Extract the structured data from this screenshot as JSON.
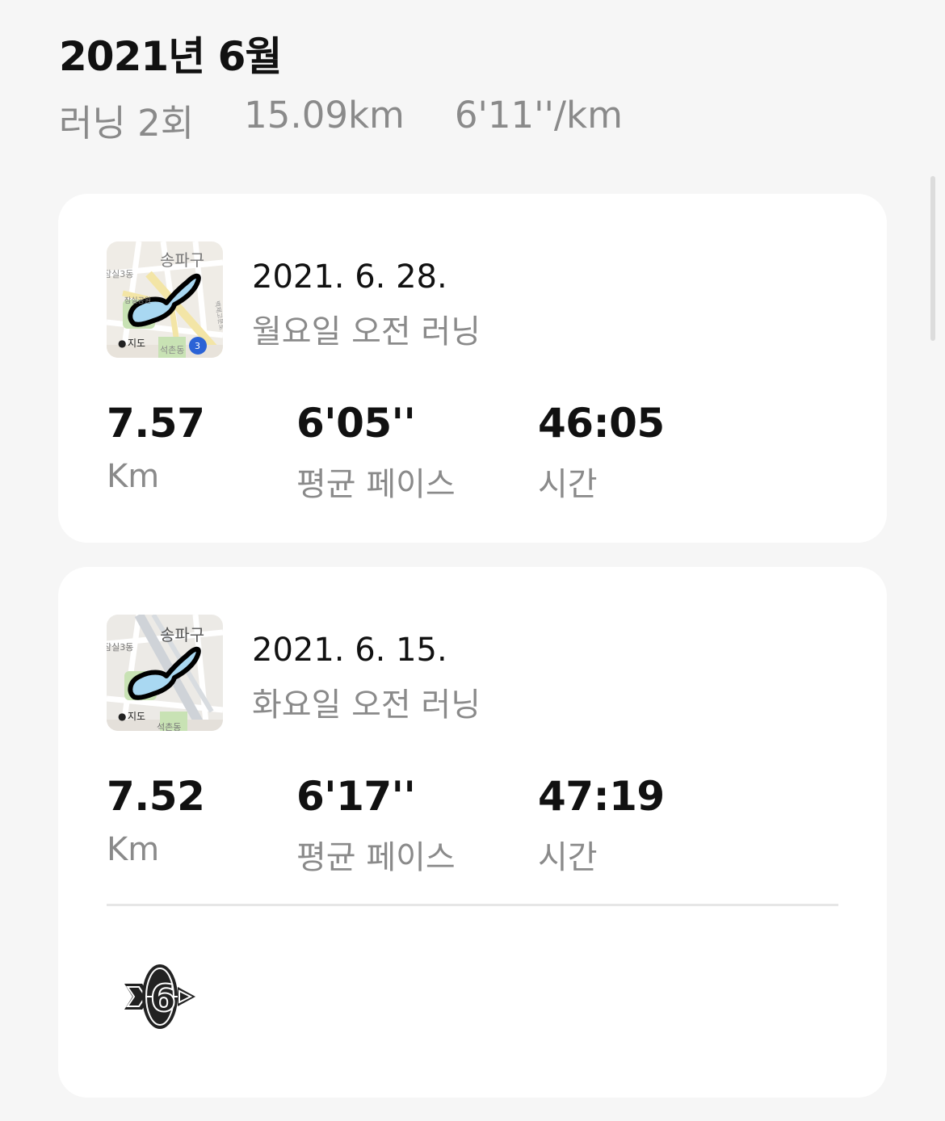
{
  "header": {
    "month_title": "2021년 6월",
    "summary": {
      "runs": "러닝 2회",
      "distance": "15.09km",
      "pace": "6'11''/km"
    }
  },
  "runs": [
    {
      "date": "2021. 6. 28.",
      "name": "월요일 오전 러닝",
      "map": {
        "district": "송파구",
        "dong_left": "잠실3동",
        "dong_bottom": "석촌동",
        "park": "잠실공원",
        "brand": "지도",
        "route_badge": "3",
        "road_label": "백제고분로"
      },
      "stats": [
        {
          "value": "7.57",
          "label": "Km"
        },
        {
          "value": "6'05''",
          "label": "평균 페이스"
        },
        {
          "value": "46:05",
          "label": "시간"
        }
      ]
    },
    {
      "date": "2021. 6. 15.",
      "name": "화요일 오전 러닝",
      "map": {
        "district": "송파구",
        "dong_left": "잠실3동",
        "dong_bottom": "석촌동",
        "brand": "지도"
      },
      "stats": [
        {
          "value": "7.52",
          "label": "Km"
        },
        {
          "value": "6'17''",
          "label": "평균 페이스"
        },
        {
          "value": "47:19",
          "label": "시간"
        }
      ],
      "badge": {
        "icon": "month-6-arrow-achievement-icon",
        "number": "6"
      }
    }
  ],
  "colors": {
    "background": "#f6f6f6",
    "card": "#ffffff",
    "text_primary": "#111111",
    "text_secondary": "#8a8a8a",
    "route_fill": "#a9d8f2",
    "route_stroke": "#000000",
    "park_green": "#c8e2b4",
    "map_road": "#f3e5a6"
  }
}
